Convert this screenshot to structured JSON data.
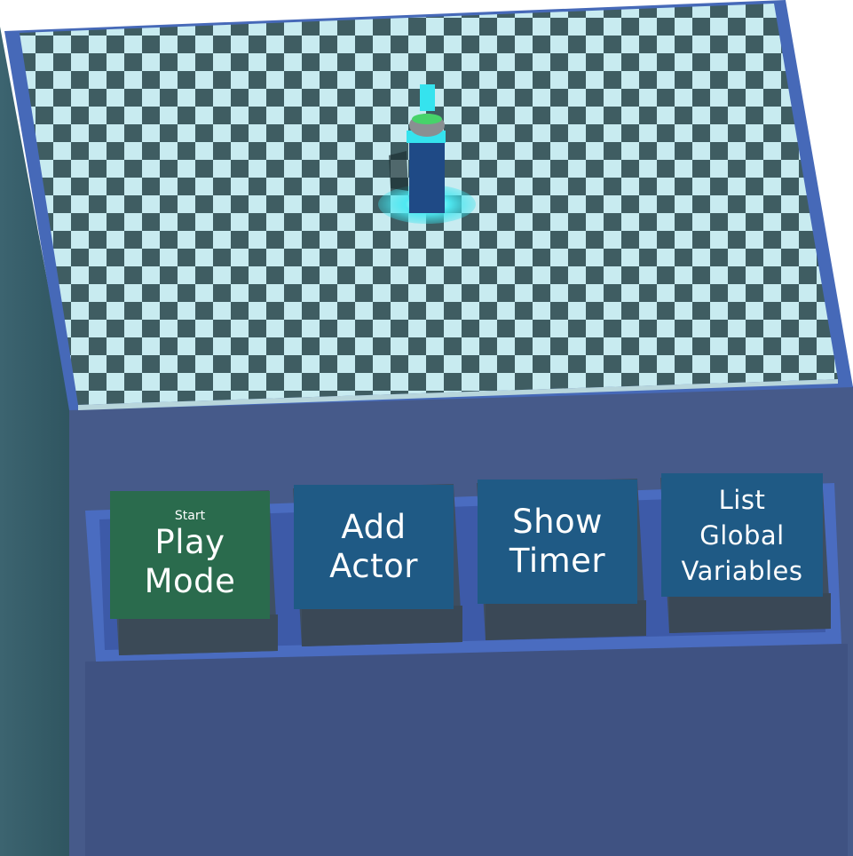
{
  "scene": {
    "name": "game-level-editor",
    "colors": {
      "checker_light": "#c8ebf0",
      "checker_dark": "#3f5d62",
      "board_frame": "#4669b8",
      "console": "#465a8a",
      "console_shadow": "#3a4b78",
      "tray": "#4a6cc0",
      "actor_body": "#1f4a86",
      "actor_glow": "#35e3ee"
    }
  },
  "controls": {
    "play": {
      "caption": "Start",
      "label_1": "Play",
      "label_2": "Mode",
      "color": "#2a6b4d"
    },
    "add_actor": {
      "label_1": "Add",
      "label_2": "Actor",
      "color": "#1f5a85"
    },
    "show_timer": {
      "label_1": "Show",
      "label_2": "Timer",
      "color": "#1f5a85"
    },
    "list_globals": {
      "label_1": "List",
      "label_2": "Global",
      "label_3": "Variables",
      "color": "#1f5a85"
    }
  }
}
